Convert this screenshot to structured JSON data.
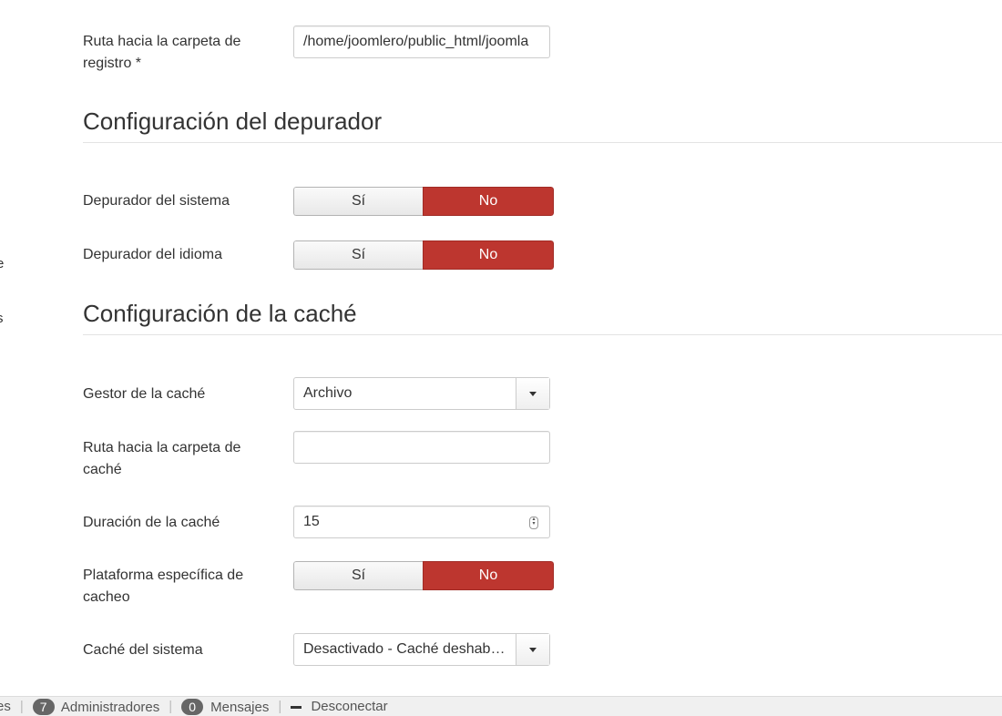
{
  "sidebar": {
    "frag1": "e",
    "frag2": "s"
  },
  "log": {
    "label": "Ruta hacia la carpeta de registro *",
    "value": "/home/joomlero/public_html/joomla"
  },
  "debug": {
    "title": "Configuración del depurador",
    "system_label": "Depurador del sistema",
    "language_label": "Depurador del idioma",
    "yes": "Sí",
    "no": "No"
  },
  "cache": {
    "title": "Configuración de la caché",
    "handler_label": "Gestor de la caché",
    "handler_value": "Archivo",
    "path_label": "Ruta hacia la carpeta de caché",
    "path_value": "",
    "time_label": "Duración de la caché",
    "time_value": "15",
    "platform_label": "Plataforma específica de cacheo",
    "system_label": "Caché del sistema",
    "system_value": "Desactivado - Caché deshab…"
  },
  "status": {
    "frag": "es",
    "admins_count": "7",
    "admins_label": "Administradores",
    "messages_count": "0",
    "messages_label": "Mensajes",
    "logout_label": "Desconectar"
  },
  "colors": {
    "active_no": "#bd362f"
  }
}
